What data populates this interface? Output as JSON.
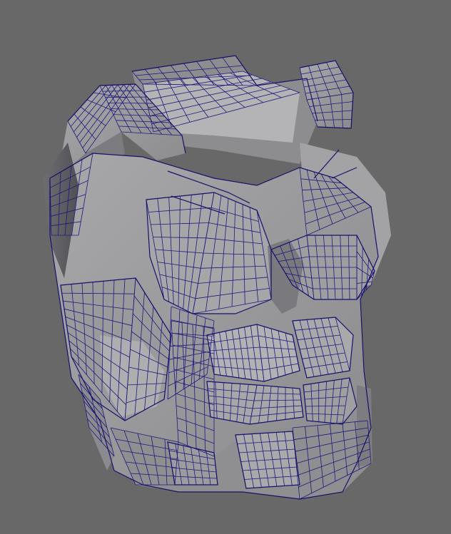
{
  "viewport": {
    "background_color": "#686868",
    "mesh_fill_color": "#9c9c9e",
    "mesh_shade_color": "#7f7f82",
    "mesh_dark_color": "#5b5b60",
    "wire_color": "#1e1a7a"
  },
  "model": {
    "subject": "chest-armor-wireframe-mesh",
    "display_mode": "shaded-with-wireframe"
  }
}
